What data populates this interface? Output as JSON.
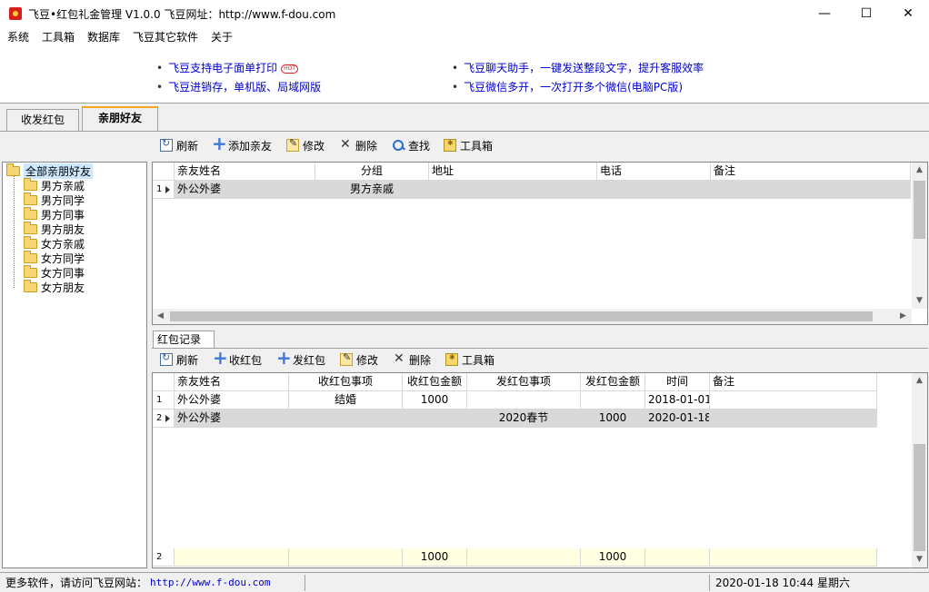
{
  "window": {
    "title": "飞豆•红包礼金管理 V1.0.0  飞豆网址：http://www.f-dou.com"
  },
  "menu": [
    "系统",
    "工具箱",
    "数据库",
    "飞豆其它软件",
    "关于"
  ],
  "news": {
    "left": [
      "飞豆支持电子面单打印",
      "飞豆进销存，单机版、局域网版"
    ],
    "right": [
      "飞豆聊天助手，一键发送整段文字，提升客服效率",
      "飞豆微信多开，一次打开多个微信(电脑PC版)"
    ],
    "hot_badge": "HOT"
  },
  "tabs": [
    "收发红包",
    "亲朋好友"
  ],
  "toolbar_top": [
    "刷新",
    "添加亲友",
    "修改",
    "删除",
    "查找",
    "工具箱"
  ],
  "tree": {
    "root": "全部亲朋好友",
    "children": [
      "男方亲戚",
      "男方同学",
      "男方同事",
      "男方朋友",
      "女方亲戚",
      "女方同学",
      "女方同事",
      "女方朋友"
    ]
  },
  "friends_grid": {
    "headers": [
      "亲友姓名",
      "分组",
      "地址",
      "电话",
      "备注"
    ],
    "rows": [
      {
        "index": "1",
        "name": "外公外婆",
        "group": "男方亲戚",
        "address": "",
        "phone": "",
        "note": ""
      }
    ]
  },
  "redpacket_tab": "红包记录",
  "toolbar_bottom": [
    "刷新",
    "收红包",
    "发红包",
    "修改",
    "删除",
    "工具箱"
  ],
  "redpacket_grid": {
    "headers": [
      "亲友姓名",
      "收红包事项",
      "收红包金额",
      "发红包事项",
      "发红包金额",
      "时间",
      "备注"
    ],
    "rows": [
      {
        "index": "1",
        "name": "外公外婆",
        "recv_event": "结婚",
        "recv_amount": "1000",
        "send_event": "",
        "send_amount": "",
        "time": "2018-01-01",
        "note": ""
      },
      {
        "index": "2",
        "name": "外公外婆",
        "recv_event": "",
        "recv_amount": "",
        "send_event": "2020春节",
        "send_amount": "1000",
        "time": "2020-01-18",
        "note": ""
      }
    ],
    "footer": {
      "count": "2",
      "recv_total": "1000",
      "send_total": "1000"
    }
  },
  "status": {
    "left_label": "更多软件，请访问飞豆网站：",
    "url": "http://www.f-dou.com",
    "datetime": "2020-01-18 10:44 星期六"
  }
}
